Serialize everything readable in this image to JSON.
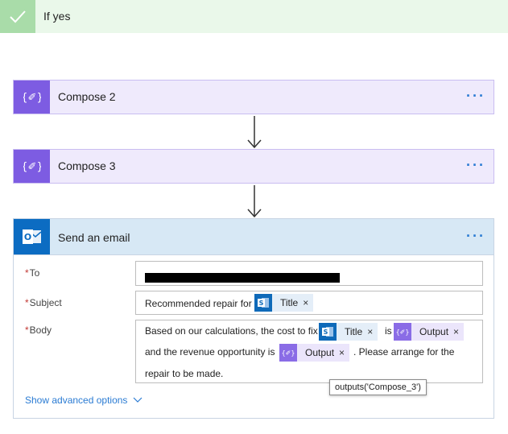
{
  "condition": {
    "label": "If yes"
  },
  "actions": [
    {
      "title": "Compose 2"
    },
    {
      "title": "Compose 3"
    }
  ],
  "email": {
    "title": "Send an email",
    "fields": {
      "to": {
        "label": "To",
        "required_mark": "*"
      },
      "subject": {
        "label": "Subject",
        "required_mark": "*",
        "text": "Recommended repair for",
        "token": "Title"
      },
      "body": {
        "label": "Body",
        "required_mark": "*",
        "text1": "Based on our calculations, the cost to fix",
        "token1": "Title",
        "text2": "is",
        "token2": "Output",
        "text3": "and the revenue opportunity is",
        "token3": "Output",
        "text4": ". Please arrange for the",
        "text5": "repair to be made."
      }
    },
    "advanced": "Show advanced options"
  },
  "menu_glyph": "···",
  "token_remove_glyph": "×",
  "tooltip": "outputs('Compose_3')",
  "colors": {
    "compose": "#7d5ce2",
    "outlook": "#0c6cc2",
    "sharepoint": "#0f6ab9",
    "link": "#2a7bd3",
    "success": "#a9dca9"
  },
  "icons": [
    "check-icon",
    "compose-icon",
    "outlook-icon",
    "sharepoint-icon",
    "more-options-icon",
    "arrow-down-icon",
    "chevron-down-icon",
    "remove-token-icon"
  ]
}
